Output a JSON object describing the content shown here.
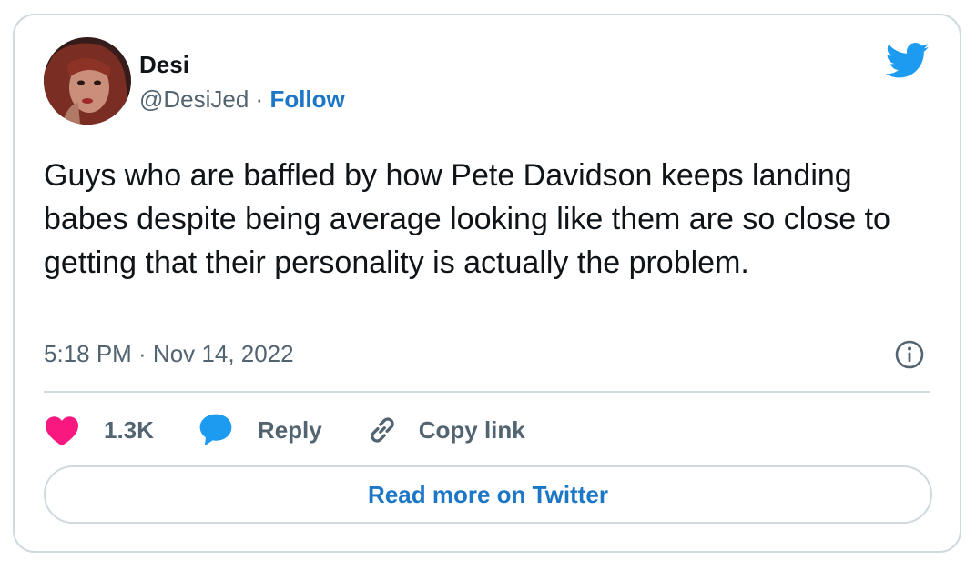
{
  "author": {
    "name": "Desi",
    "handle": "@DesiJed",
    "separator": " · ",
    "follow_label": "Follow"
  },
  "tweet": {
    "text": "Guys who are baffled by how Pete Davidson keeps landing babes despite being average looking like them are so close to getting that their personality is actually the problem.",
    "timestamp": "5:18 PM · Nov 14, 2022"
  },
  "actions": {
    "like_count": "1.3K",
    "reply_label": "Reply",
    "copy_link_label": "Copy link"
  },
  "read_more_label": "Read more on Twitter",
  "icons": {
    "brand": "twitter-bird-icon",
    "info": "info-icon",
    "like": "heart-icon",
    "reply": "speech-bubble-icon",
    "copy": "link-icon"
  },
  "colors": {
    "brand_blue": "#1d9bf0",
    "link_blue": "#1d77c7",
    "heart": "#f91880",
    "secondary_text": "#536471",
    "border": "#cfd9de"
  }
}
